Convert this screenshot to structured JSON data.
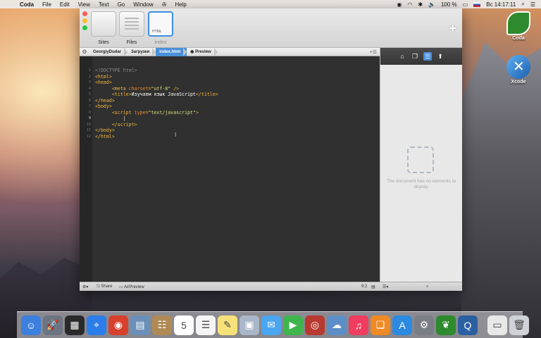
{
  "menubar": {
    "app_name": "Coda",
    "items": [
      "File",
      "Edit",
      "View",
      "Text",
      "Go",
      "Window",
      "Help"
    ],
    "battery": "100 %",
    "clock": "Вс 14:17:11"
  },
  "toolbar": {
    "tabs": [
      {
        "label": "Sites"
      },
      {
        "label": "Files"
      },
      {
        "label": "index"
      }
    ],
    "index_tile_text": "HTML"
  },
  "pathbar": {
    "crumbs": [
      "GeorgiyDudar",
      "Загрузки",
      "index.html"
    ],
    "preview_label": "Preview"
  },
  "editor": {
    "line_numbers": [
      "1",
      "2",
      "3",
      "4",
      "5",
      "6",
      "7",
      "8",
      "9",
      "10",
      "11",
      "12"
    ]
  },
  "sidebar": {
    "empty_message": "The document has no elements to display."
  },
  "statusbar": {
    "share_label": "Share",
    "airpreview_label": "AirPreview",
    "position": "9:2"
  },
  "desktop": {
    "icons": [
      {
        "label": "Coda",
        "icon": "coda-leaf-icon"
      },
      {
        "label": "Xcode",
        "icon": "xcode-icon"
      }
    ]
  },
  "dock": {
    "apps": [
      {
        "name": "Finder",
        "color": "#3d7fdc",
        "glyph": "☺"
      },
      {
        "name": "Launchpad",
        "color": "#6b7480",
        "glyph": "🚀"
      },
      {
        "name": "Dashboard",
        "color": "#2a2a2a",
        "glyph": "▦"
      },
      {
        "name": "Safari",
        "color": "#2b7de9",
        "glyph": "⌖"
      },
      {
        "name": "Chrome",
        "color": "#d8402e",
        "glyph": "◉"
      },
      {
        "name": "Preview",
        "color": "#6a8fb8",
        "glyph": "▤"
      },
      {
        "name": "Contacts",
        "color": "#b08a56",
        "glyph": "☷"
      },
      {
        "name": "Calendar",
        "color": "#ffffff",
        "glyph": "5"
      },
      {
        "name": "Reminders",
        "color": "#f5f5f5",
        "glyph": "☰"
      },
      {
        "name": "Notes",
        "color": "#f7e27a",
        "glyph": "✎"
      },
      {
        "name": "Photo Booth",
        "color": "#a9b7c8",
        "glyph": "▣"
      },
      {
        "name": "Messages",
        "color": "#4aa6f0",
        "glyph": "✉"
      },
      {
        "name": "FaceTime",
        "color": "#3fb54e",
        "glyph": "▶"
      },
      {
        "name": "Photo Booth 2",
        "color": "#b8392f",
        "glyph": "◎"
      },
      {
        "name": "iPhoto",
        "color": "#5c8fc7",
        "glyph": "☁"
      },
      {
        "name": "iTunes",
        "color": "#f03c5e",
        "glyph": "♫"
      },
      {
        "name": "iBooks",
        "color": "#f08a24",
        "glyph": "❏"
      },
      {
        "name": "App Store",
        "color": "#2c8be0",
        "glyph": "A"
      },
      {
        "name": "System Preferences",
        "color": "#7a7f86",
        "glyph": "⚙"
      },
      {
        "name": "Coda",
        "color": "#2d8a2d",
        "glyph": "❦"
      },
      {
        "name": "QuickTime",
        "color": "#2a5fa0",
        "glyph": "Q"
      },
      {
        "name": "Downloads",
        "color": "#e8e8e8",
        "glyph": "▭"
      },
      {
        "name": "Trash",
        "color": "#cfd3d8",
        "glyph": "🗑"
      }
    ]
  },
  "colors": {
    "accent": "#4a90d9",
    "editor_bg": "#303030",
    "tag": "#f4b73c",
    "attr": "#e9892e",
    "string": "#d9e27a"
  }
}
